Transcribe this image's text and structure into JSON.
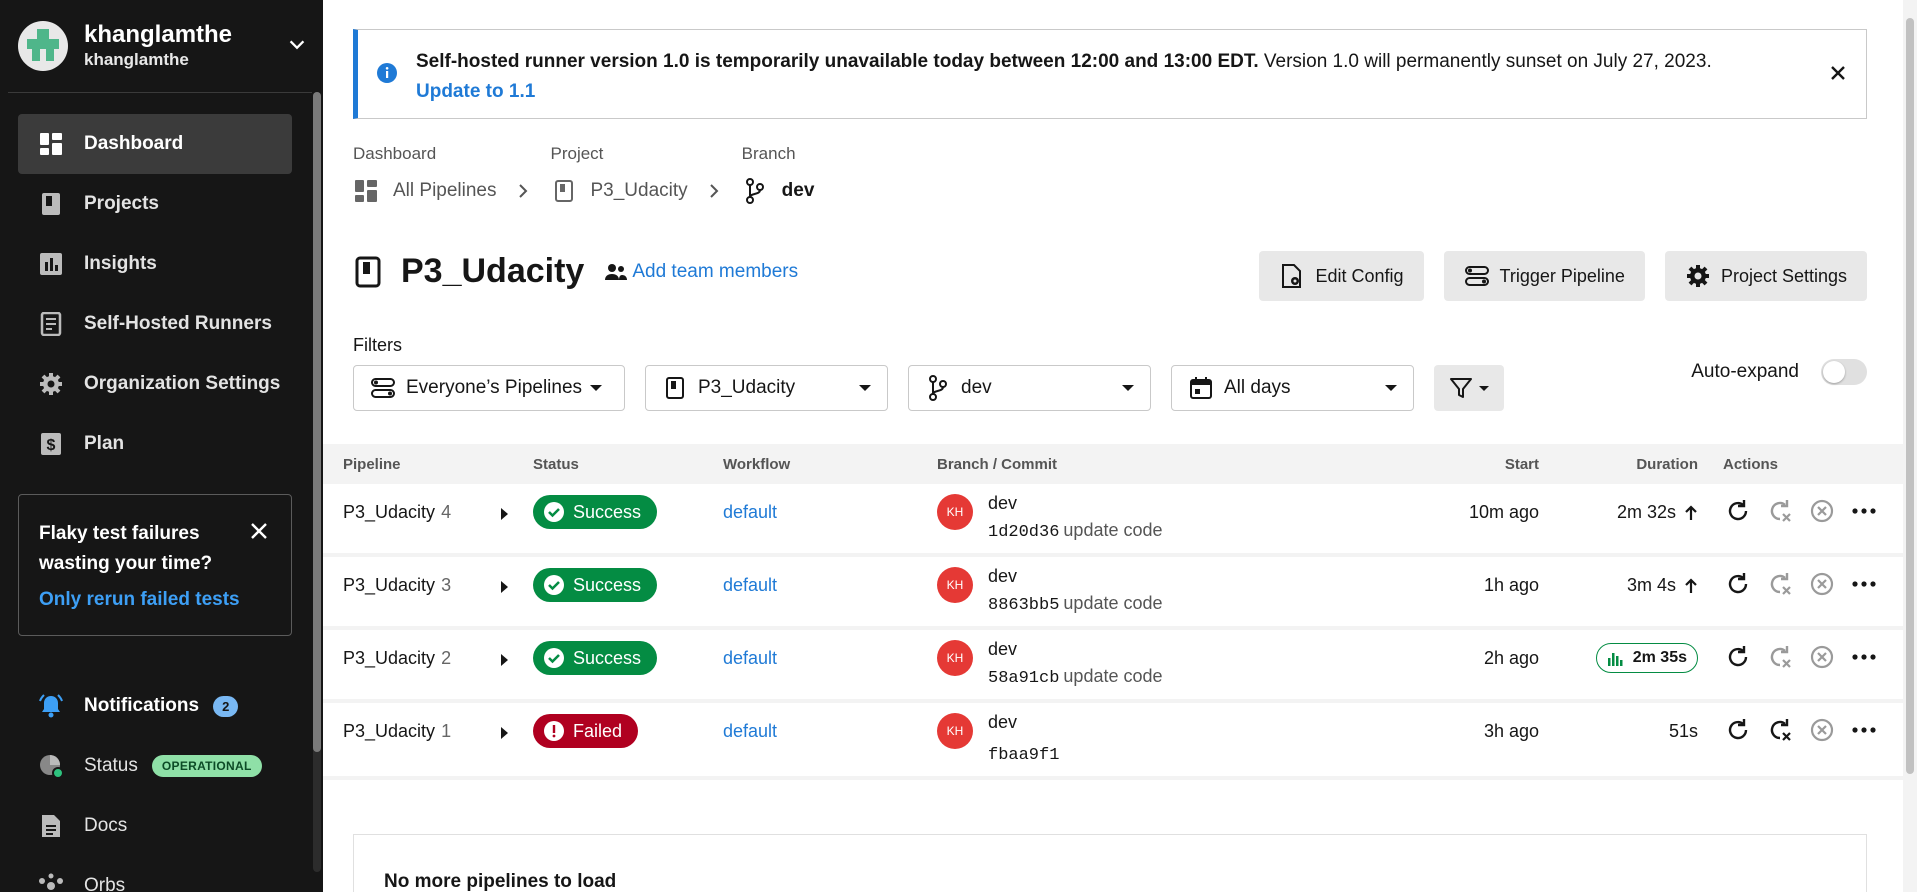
{
  "org": {
    "name": "khanglamthe",
    "sub": "khanglamthe"
  },
  "nav": [
    {
      "label": "Dashboard",
      "icon": "dashboard-icon",
      "active": true
    },
    {
      "label": "Projects",
      "icon": "projects-icon"
    },
    {
      "label": "Insights",
      "icon": "insights-icon"
    },
    {
      "label": "Self-Hosted Runners",
      "icon": "runners-icon"
    },
    {
      "label": "Organization Settings",
      "icon": "gear-icon"
    },
    {
      "label": "Plan",
      "icon": "dollar-icon"
    }
  ],
  "promo": {
    "title": "Flaky test failures wasting your time?",
    "link": "Only rerun failed tests"
  },
  "bottom_nav": {
    "notifications": {
      "label": "Notifications",
      "count": "2"
    },
    "status": {
      "label": "Status",
      "badge": "OPERATIONAL"
    },
    "docs": {
      "label": "Docs"
    },
    "orbs": {
      "label": "Orbs"
    }
  },
  "banner": {
    "bold": "Self-hosted runner version 1.0 is temporarily unavailable today between 12:00 and 13:00 EDT.",
    "text": " Version 1.0 will permanently sunset on July 27, 2023.",
    "link": "Update to 1.1"
  },
  "breadcrumbs": [
    {
      "label": "Dashboard",
      "value": "All Pipelines",
      "icon": "dashboard-icon"
    },
    {
      "label": "Project",
      "value": "P3_Udacity",
      "icon": "project-icon"
    },
    {
      "label": "Branch",
      "value": "dev",
      "icon": "branch-icon"
    }
  ],
  "title": "P3_Udacity",
  "add_members": "Add team members",
  "buttons": {
    "edit_config": "Edit Config",
    "trigger": "Trigger Pipeline",
    "settings": "Project Settings"
  },
  "filters": {
    "label": "Filters",
    "pipelines": "Everyone’s Pipelines",
    "project": "P3_Udacity",
    "branch": "dev",
    "days": "All days",
    "auto_expand": "Auto-expand"
  },
  "table": {
    "headers": {
      "pipeline": "Pipeline",
      "status": "Status",
      "workflow": "Workflow",
      "branch": "Branch / Commit",
      "start": "Start",
      "duration": "Duration",
      "actions": "Actions"
    },
    "rows": [
      {
        "name": "P3_Udacity",
        "num": "4",
        "status": "Success",
        "workflow": "default",
        "avatar": "KH",
        "branch": "dev",
        "hash": "1d20d36",
        "msg": "update code",
        "start": "10m ago",
        "duration": "2m 32s",
        "dur_style": "arrow"
      },
      {
        "name": "P3_Udacity",
        "num": "3",
        "status": "Success",
        "workflow": "default",
        "avatar": "KH",
        "branch": "dev",
        "hash": "8863bb5",
        "msg": "update code",
        "start": "1h ago",
        "duration": "3m 4s",
        "dur_style": "arrow"
      },
      {
        "name": "P3_Udacity",
        "num": "2",
        "status": "Success",
        "workflow": "default",
        "avatar": "KH",
        "branch": "dev",
        "hash": "58a91cb",
        "msg": "update code",
        "start": "2h ago",
        "duration": "2m 35s",
        "dur_style": "badge"
      },
      {
        "name": "P3_Udacity",
        "num": "1",
        "status": "Failed",
        "workflow": "default",
        "avatar": "KH",
        "branch": "dev",
        "hash": "fbaa9f1",
        "msg": "",
        "start": "3h ago",
        "duration": "51s",
        "dur_style": "plain"
      }
    ]
  },
  "no_more": "No more pipelines to load",
  "colors": {
    "accent": "#1f7ad6",
    "success": "#048c43",
    "failed": "#b00020",
    "sidebar": "#161616"
  }
}
